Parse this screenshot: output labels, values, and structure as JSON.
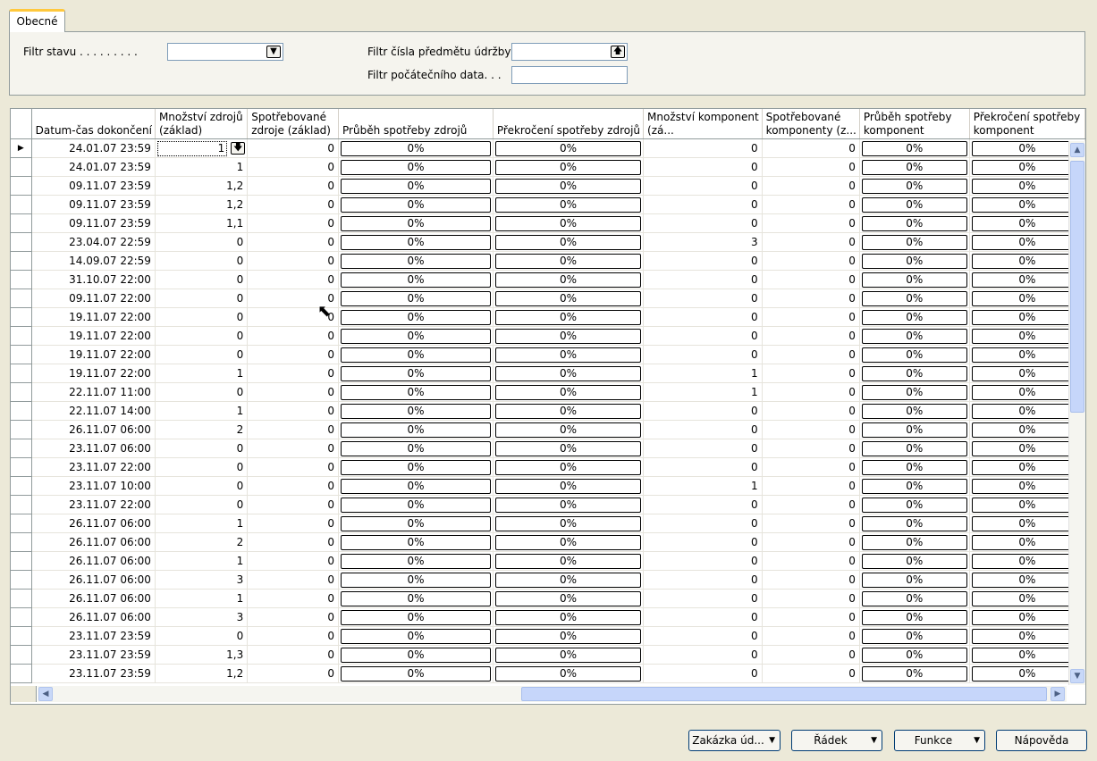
{
  "tab": {
    "label": "Obecné"
  },
  "filters": {
    "status_label": "Filtr stavu . . . . . . . . .",
    "status_value": "",
    "item_no_label": "Filtr čísla předmětu údržby",
    "item_no_value": "",
    "start_date_label": "Filtr počátečního data. . .",
    "start_date_value": ""
  },
  "columns": [
    "Datum-čas dokončení",
    "Množství zdrojů (základ)",
    "Spotřebované zdroje (základ)",
    "Průběh spotřeby zdrojů",
    "Překročení spotřeby zdrojů",
    "Množství komponent (zá...",
    "Spotřebované komponenty (z...",
    "Průběh spotřeby komponent",
    "Překročení spotřeby komponent"
  ],
  "rows": [
    {
      "date": "24.01.07 23:59",
      "res_qty": "1",
      "res_used": "0",
      "res_prog": "0%",
      "res_over": "0%",
      "comp_qty": "0",
      "comp_used": "0",
      "comp_prog": "0%",
      "comp_over": "0%"
    },
    {
      "date": "24.01.07 23:59",
      "res_qty": "1",
      "res_used": "0",
      "res_prog": "0%",
      "res_over": "0%",
      "comp_qty": "0",
      "comp_used": "0",
      "comp_prog": "0%",
      "comp_over": "0%"
    },
    {
      "date": "09.11.07 23:59",
      "res_qty": "1,2",
      "res_used": "0",
      "res_prog": "0%",
      "res_over": "0%",
      "comp_qty": "0",
      "comp_used": "0",
      "comp_prog": "0%",
      "comp_over": "0%"
    },
    {
      "date": "09.11.07 23:59",
      "res_qty": "1,2",
      "res_used": "0",
      "res_prog": "0%",
      "res_over": "0%",
      "comp_qty": "0",
      "comp_used": "0",
      "comp_prog": "0%",
      "comp_over": "0%"
    },
    {
      "date": "09.11.07 23:59",
      "res_qty": "1,1",
      "res_used": "0",
      "res_prog": "0%",
      "res_over": "0%",
      "comp_qty": "0",
      "comp_used": "0",
      "comp_prog": "0%",
      "comp_over": "0%"
    },
    {
      "date": "23.04.07 22:59",
      "res_qty": "0",
      "res_used": "0",
      "res_prog": "0%",
      "res_over": "0%",
      "comp_qty": "3",
      "comp_used": "0",
      "comp_prog": "0%",
      "comp_over": "0%"
    },
    {
      "date": "14.09.07 22:59",
      "res_qty": "0",
      "res_used": "0",
      "res_prog": "0%",
      "res_over": "0%",
      "comp_qty": "0",
      "comp_used": "0",
      "comp_prog": "0%",
      "comp_over": "0%"
    },
    {
      "date": "31.10.07 22:00",
      "res_qty": "0",
      "res_used": "0",
      "res_prog": "0%",
      "res_over": "0%",
      "comp_qty": "0",
      "comp_used": "0",
      "comp_prog": "0%",
      "comp_over": "0%"
    },
    {
      "date": "09.11.07 22:00",
      "res_qty": "0",
      "res_used": "0",
      "res_prog": "0%",
      "res_over": "0%",
      "comp_qty": "0",
      "comp_used": "0",
      "comp_prog": "0%",
      "comp_over": "0%"
    },
    {
      "date": "19.11.07 22:00",
      "res_qty": "0",
      "res_used": "0",
      "res_prog": "0%",
      "res_over": "0%",
      "comp_qty": "0",
      "comp_used": "0",
      "comp_prog": "0%",
      "comp_over": "0%"
    },
    {
      "date": "19.11.07 22:00",
      "res_qty": "0",
      "res_used": "0",
      "res_prog": "0%",
      "res_over": "0%",
      "comp_qty": "0",
      "comp_used": "0",
      "comp_prog": "0%",
      "comp_over": "0%"
    },
    {
      "date": "19.11.07 22:00",
      "res_qty": "0",
      "res_used": "0",
      "res_prog": "0%",
      "res_over": "0%",
      "comp_qty": "0",
      "comp_used": "0",
      "comp_prog": "0%",
      "comp_over": "0%"
    },
    {
      "date": "19.11.07 22:00",
      "res_qty": "1",
      "res_used": "0",
      "res_prog": "0%",
      "res_over": "0%",
      "comp_qty": "1",
      "comp_used": "0",
      "comp_prog": "0%",
      "comp_over": "0%"
    },
    {
      "date": "22.11.07 11:00",
      "res_qty": "0",
      "res_used": "0",
      "res_prog": "0%",
      "res_over": "0%",
      "comp_qty": "1",
      "comp_used": "0",
      "comp_prog": "0%",
      "comp_over": "0%"
    },
    {
      "date": "22.11.07 14:00",
      "res_qty": "1",
      "res_used": "0",
      "res_prog": "0%",
      "res_over": "0%",
      "comp_qty": "0",
      "comp_used": "0",
      "comp_prog": "0%",
      "comp_over": "0%"
    },
    {
      "date": "26.11.07 06:00",
      "res_qty": "2",
      "res_used": "0",
      "res_prog": "0%",
      "res_over": "0%",
      "comp_qty": "0",
      "comp_used": "0",
      "comp_prog": "0%",
      "comp_over": "0%"
    },
    {
      "date": "23.11.07 06:00",
      "res_qty": "0",
      "res_used": "0",
      "res_prog": "0%",
      "res_over": "0%",
      "comp_qty": "0",
      "comp_used": "0",
      "comp_prog": "0%",
      "comp_over": "0%"
    },
    {
      "date": "23.11.07 22:00",
      "res_qty": "0",
      "res_used": "0",
      "res_prog": "0%",
      "res_over": "0%",
      "comp_qty": "0",
      "comp_used": "0",
      "comp_prog": "0%",
      "comp_over": "0%"
    },
    {
      "date": "23.11.07 10:00",
      "res_qty": "0",
      "res_used": "0",
      "res_prog": "0%",
      "res_over": "0%",
      "comp_qty": "1",
      "comp_used": "0",
      "comp_prog": "0%",
      "comp_over": "0%"
    },
    {
      "date": "23.11.07 22:00",
      "res_qty": "0",
      "res_used": "0",
      "res_prog": "0%",
      "res_over": "0%",
      "comp_qty": "0",
      "comp_used": "0",
      "comp_prog": "0%",
      "comp_over": "0%"
    },
    {
      "date": "26.11.07 06:00",
      "res_qty": "1",
      "res_used": "0",
      "res_prog": "0%",
      "res_over": "0%",
      "comp_qty": "0",
      "comp_used": "0",
      "comp_prog": "0%",
      "comp_over": "0%"
    },
    {
      "date": "26.11.07 06:00",
      "res_qty": "2",
      "res_used": "0",
      "res_prog": "0%",
      "res_over": "0%",
      "comp_qty": "0",
      "comp_used": "0",
      "comp_prog": "0%",
      "comp_over": "0%"
    },
    {
      "date": "26.11.07 06:00",
      "res_qty": "1",
      "res_used": "0",
      "res_prog": "0%",
      "res_over": "0%",
      "comp_qty": "0",
      "comp_used": "0",
      "comp_prog": "0%",
      "comp_over": "0%"
    },
    {
      "date": "26.11.07 06:00",
      "res_qty": "3",
      "res_used": "0",
      "res_prog": "0%",
      "res_over": "0%",
      "comp_qty": "0",
      "comp_used": "0",
      "comp_prog": "0%",
      "comp_over": "0%"
    },
    {
      "date": "26.11.07 06:00",
      "res_qty": "1",
      "res_used": "0",
      "res_prog": "0%",
      "res_over": "0%",
      "comp_qty": "0",
      "comp_used": "0",
      "comp_prog": "0%",
      "comp_over": "0%"
    },
    {
      "date": "26.11.07 06:00",
      "res_qty": "3",
      "res_used": "0",
      "res_prog": "0%",
      "res_over": "0%",
      "comp_qty": "0",
      "comp_used": "0",
      "comp_prog": "0%",
      "comp_over": "0%"
    },
    {
      "date": "23.11.07 23:59",
      "res_qty": "0",
      "res_used": "0",
      "res_prog": "0%",
      "res_over": "0%",
      "comp_qty": "0",
      "comp_used": "0",
      "comp_prog": "0%",
      "comp_over": "0%"
    },
    {
      "date": "23.11.07 23:59",
      "res_qty": "1,3",
      "res_used": "0",
      "res_prog": "0%",
      "res_over": "0%",
      "comp_qty": "0",
      "comp_used": "0",
      "comp_prog": "0%",
      "comp_over": "0%"
    },
    {
      "date": "23.11.07 23:59",
      "res_qty": "1,2",
      "res_used": "0",
      "res_prog": "0%",
      "res_over": "0%",
      "comp_qty": "0",
      "comp_used": "0",
      "comp_prog": "0%",
      "comp_over": "0%"
    }
  ],
  "buttons": {
    "order": "Zakázka úd...",
    "line": "Řádek",
    "functions": "Funkce",
    "help": "Nápověda"
  },
  "icons": {
    "row_selector": "triangle-right-icon",
    "dropdown": "chevron-down-icon",
    "lookup": "arrow-up-icon",
    "scroll_up": "scroll-up-icon",
    "scroll_down": "scroll-down-icon",
    "scroll_left": "scroll-left-icon",
    "scroll_right": "scroll-right-icon"
  }
}
